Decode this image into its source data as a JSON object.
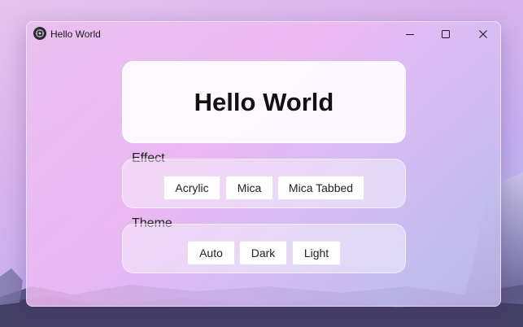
{
  "window": {
    "title": "Hello World",
    "icon": "app-icon",
    "controls": {
      "minimize": "minimize-icon",
      "maximize": "maximize-icon",
      "close": "close-icon"
    }
  },
  "main": {
    "heading": "Hello World",
    "effect": {
      "label": "Effect",
      "options": [
        "Acrylic",
        "Mica",
        "Mica Tabbed"
      ]
    },
    "theme": {
      "label": "Theme",
      "options": [
        "Auto",
        "Dark",
        "Light"
      ]
    }
  },
  "colors": {
    "card": "#ffffff",
    "text": "#111111",
    "accent_gradient_start": "#e9c0f0",
    "accent_gradient_end": "#bcb4e4"
  }
}
